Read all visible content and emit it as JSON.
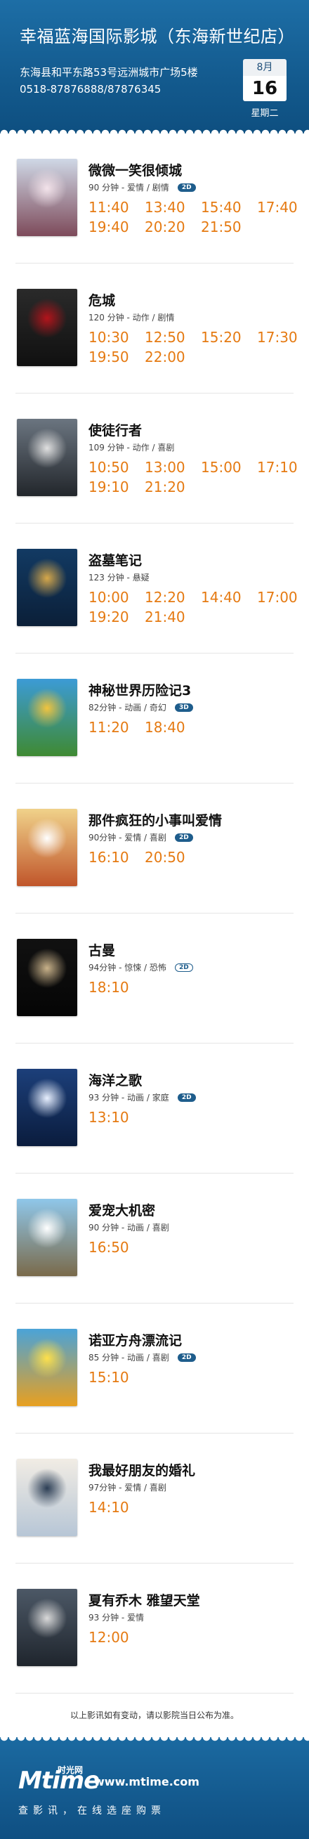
{
  "header": {
    "cinema_name": "幸福蓝海国际影城（东海新世纪店）",
    "address": "东海县和平东路53号远洲城市广场5楼",
    "phone": "0518-87876888/87876345",
    "date": {
      "month": "8月",
      "day": "16",
      "weekday": "星期二"
    }
  },
  "movies": [
    {
      "title": "微微一笑很倾城",
      "info": "90 分钟 - 爱情 / 剧情",
      "badge": "2D",
      "badge_style": "filled",
      "poster": {
        "top": "#cfd8e6",
        "bottom": "#7d4a5a",
        "accent": "#f3e3ea"
      },
      "times": [
        "11:40",
        "13:40",
        "15:40",
        "17:40",
        "19:40",
        "20:20",
        "21:50"
      ]
    },
    {
      "title": "危城",
      "info": "120 分钟 - 动作 / 剧情",
      "badge": "",
      "poster": {
        "top": "#2a2a2a",
        "bottom": "#101010",
        "accent": "#b3141b"
      },
      "times": [
        "10:30",
        "12:50",
        "15:20",
        "17:30",
        "19:50",
        "22:00"
      ]
    },
    {
      "title": "使徒行者",
      "info": "109 分钟 - 动作 / 喜剧",
      "badge": "",
      "poster": {
        "top": "#6b7580",
        "bottom": "#22262b",
        "accent": "#e0e0e0"
      },
      "times": [
        "10:50",
        "13:00",
        "15:00",
        "17:10",
        "19:10",
        "21:20"
      ]
    },
    {
      "title": "盗墓笔记",
      "info": "123 分钟 - 悬疑",
      "badge": "",
      "poster": {
        "top": "#123a63",
        "bottom": "#0b1f38",
        "accent": "#d7a84a"
      },
      "times": [
        "10:00",
        "12:20",
        "14:40",
        "17:00",
        "19:20",
        "21:40"
      ]
    },
    {
      "title": "神秘世界历险记3",
      "info": "82分钟 - 动画 / 奇幻",
      "badge": "3D",
      "badge_style": "filled",
      "poster": {
        "top": "#3c9bd6",
        "bottom": "#3f8a32",
        "accent": "#f2c43d"
      },
      "times": [
        "11:20",
        "18:40"
      ]
    },
    {
      "title": "那件疯狂的小事叫爱情",
      "info": "90分钟 - 爱情 / 喜剧",
      "badge": "2D",
      "badge_style": "filled",
      "poster": {
        "top": "#f0d28a",
        "bottom": "#c0552a",
        "accent": "#ffffff"
      },
      "times": [
        "16:10",
        "20:50"
      ]
    },
    {
      "title": "古曼",
      "info": "94分钟 - 惊悚 / 恐怖",
      "badge": "2D",
      "badge_style": "outline",
      "poster": {
        "top": "#111111",
        "bottom": "#050505",
        "accent": "#c9b28a"
      },
      "times": [
        "18:10"
      ]
    },
    {
      "title": "海洋之歌",
      "info": "93 分钟 - 动画 / 家庭",
      "badge": "2D",
      "badge_style": "filled",
      "poster": {
        "top": "#1c3f7a",
        "bottom": "#0a1c3d",
        "accent": "#e8f0ff"
      },
      "times": [
        "13:10"
      ]
    },
    {
      "title": "爱宠大机密",
      "info": "90 分钟 - 动画 / 喜剧",
      "badge": "",
      "poster": {
        "top": "#8fc7ea",
        "bottom": "#7a6a4a",
        "accent": "#ffffff"
      },
      "times": [
        "16:50"
      ]
    },
    {
      "title": "诺亚方舟漂流记",
      "info": "85 分钟 - 动画 / 喜剧",
      "badge": "2D",
      "badge_style": "filled",
      "poster": {
        "top": "#4aa3d8",
        "bottom": "#e8a020",
        "accent": "#ffe04a"
      },
      "times": [
        "15:10"
      ]
    },
    {
      "title": "我最好朋友的婚礼",
      "info": "97分钟 - 爱情 / 喜剧",
      "badge": "",
      "poster": {
        "top": "#f1ece4",
        "bottom": "#b7c6d6",
        "accent": "#2c3e55"
      },
      "times": [
        "14:10"
      ]
    },
    {
      "title": "夏有乔木 雅望天堂",
      "info": "93 分钟 - 爱情",
      "badge": "",
      "poster": {
        "top": "#4c5866",
        "bottom": "#1f252d",
        "accent": "#d9d9d9"
      },
      "times": [
        "12:00"
      ]
    }
  ],
  "footer": {
    "note": "以上影讯如有变动，请以影院当日公布为准。",
    "brand": "Mtime",
    "brand_cn": "时光网",
    "url": "www.mtime.com",
    "slogan": "查影讯，在线选座购票"
  },
  "colors": {
    "header_blue": "#1d6ea6",
    "time_orange": "#e57a12",
    "badge_blue": "#1e5d8c"
  }
}
